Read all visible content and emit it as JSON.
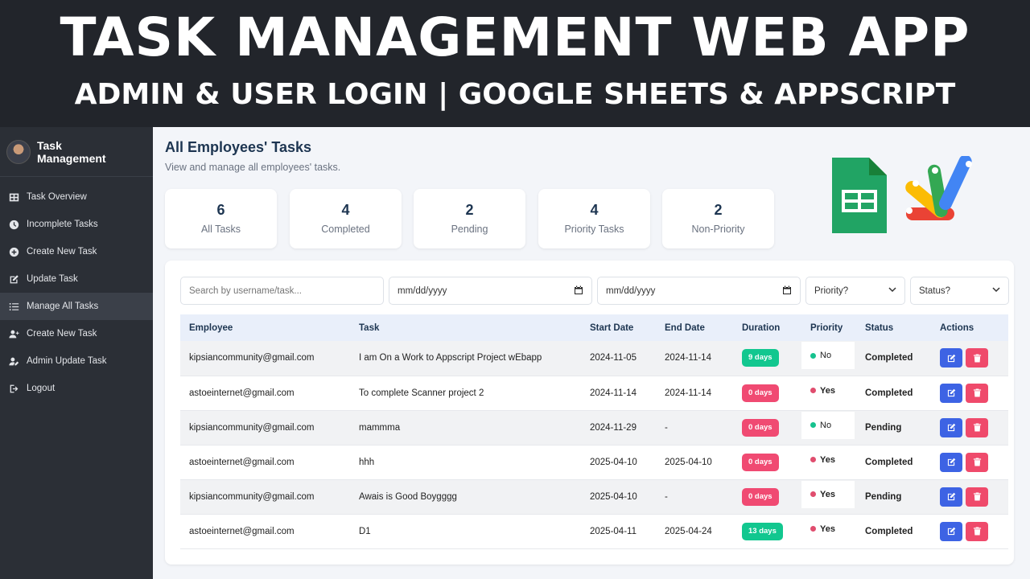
{
  "banner": {
    "title": "TASK MANAGEMENT WEB APP",
    "subtitle": "ADMIN & USER LOGIN | GOOGLE SHEETS & APPSCRIPT"
  },
  "sidebar": {
    "brand": "Task Management",
    "items": [
      {
        "label": "Task Overview",
        "icon": "grid-icon"
      },
      {
        "label": "Incomplete Tasks",
        "icon": "clock-icon"
      },
      {
        "label": "Create New Task",
        "icon": "plus-circle-icon"
      },
      {
        "label": "Update Task",
        "icon": "edit-icon"
      },
      {
        "label": "Manage All Tasks",
        "icon": "list-icon",
        "active": true
      },
      {
        "label": "Create New Task",
        "icon": "user-plus-icon"
      },
      {
        "label": "Admin Update Task",
        "icon": "user-edit-icon"
      },
      {
        "label": "Logout",
        "icon": "logout-icon"
      }
    ]
  },
  "main": {
    "title": "All Employees' Tasks",
    "subtitle": "View and manage all employees' tasks."
  },
  "stats": [
    {
      "value": "6",
      "label": "All Tasks"
    },
    {
      "value": "4",
      "label": "Completed"
    },
    {
      "value": "2",
      "label": "Pending"
    },
    {
      "value": "4",
      "label": "Priority Tasks"
    },
    {
      "value": "2",
      "label": "Non-Priority"
    }
  ],
  "filters": {
    "search_placeholder": "Search by username/task...",
    "start_date": "mm/dd/yyyy",
    "end_date": "mm/dd/yyyy",
    "priority": "Priority?",
    "status": "Status?"
  },
  "table": {
    "headers": [
      "Employee",
      "Task",
      "Start Date",
      "End Date",
      "Duration",
      "Priority",
      "Status",
      "Actions"
    ],
    "rows": [
      {
        "employee": "kipsiancommunity@gmail.com",
        "task": "I am On a Work to Appscript Project wEbapp",
        "start": "2024-11-05",
        "end": "2024-11-14",
        "duration": "9 days",
        "priority": "No",
        "status": "Completed"
      },
      {
        "employee": "astoeinternet@gmail.com",
        "task": "To complete Scanner project 2",
        "start": "2024-11-14",
        "end": "2024-11-14",
        "duration": "0 days",
        "priority": "Yes",
        "status": "Completed"
      },
      {
        "employee": "kipsiancommunity@gmail.com",
        "task": "mammma",
        "start": "2024-11-29",
        "end": "-",
        "duration": "0 days",
        "priority": "No",
        "status": "Pending"
      },
      {
        "employee": "astoeinternet@gmail.com",
        "task": "hhh",
        "start": "2025-04-10",
        "end": "2025-04-10",
        "duration": "0 days",
        "priority": "Yes",
        "status": "Completed"
      },
      {
        "employee": "kipsiancommunity@gmail.com",
        "task": "Awais is Good Boygggg",
        "start": "2025-04-10",
        "end": "-",
        "duration": "0 days",
        "priority": "Yes",
        "status": "Pending"
      },
      {
        "employee": "astoeinternet@gmail.com",
        "task": "D1",
        "start": "2025-04-11",
        "end": "2025-04-24",
        "duration": "13 days",
        "priority": "Yes",
        "status": "Completed"
      }
    ]
  },
  "colors": {
    "sidebar_bg": "#2b2f36",
    "accent_blue": "#3d63e4",
    "danger": "#ef4a6b",
    "success": "#12c78f"
  }
}
